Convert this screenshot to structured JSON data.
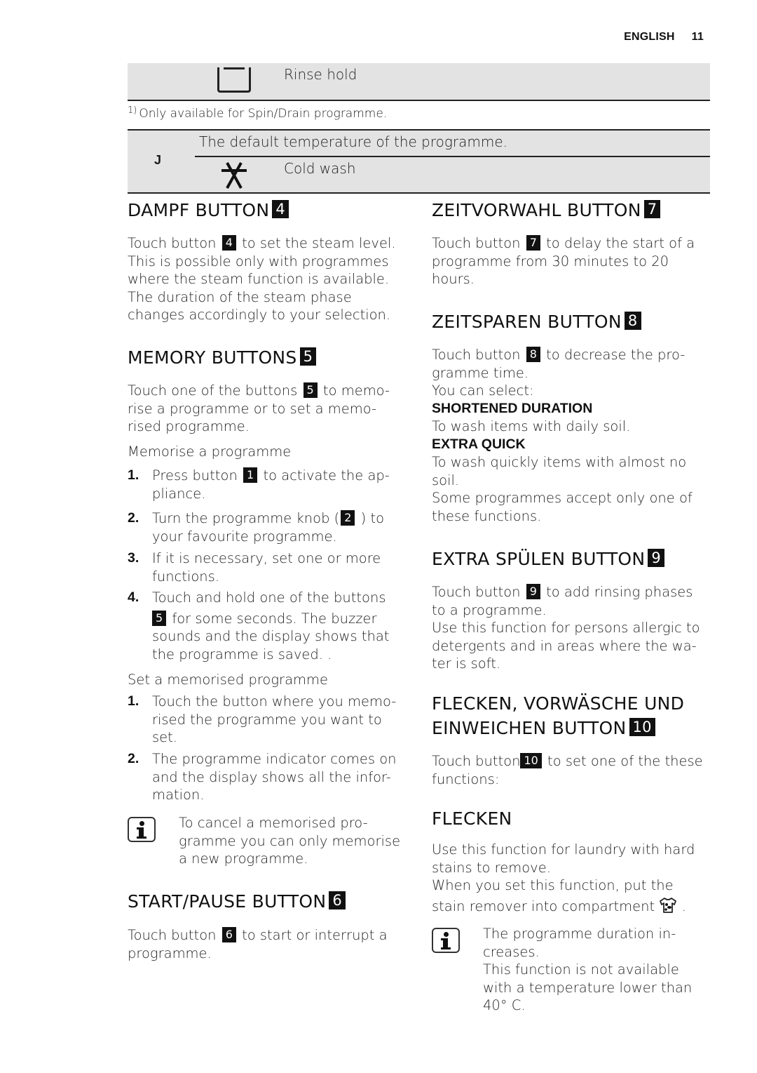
{
  "header": {
    "language": "ENGLISH",
    "page_number": "11"
  },
  "table": {
    "rinse_hold": {
      "icon": "rinse-hold-icon",
      "label": "Rinse hold"
    },
    "footnote": {
      "marker": "1)",
      "text": "Only available for Spin/Drain programme."
    },
    "temperature": {
      "key": "J",
      "description": "The default temperature of the programme.",
      "cold_wash": {
        "icon": "cold-wash-icon",
        "label": "Cold wash"
      }
    }
  },
  "left": {
    "dampf": {
      "title": "DAMPF BUTTON",
      "badge": "4",
      "p1_pre": "Touch button",
      "p1_badge": "4",
      "p1_post": "to set the steam level.",
      "lines": [
        "This is possible only with programmes",
        "where the steam function is available.",
        "The duration of the steam phase",
        "changes accordingly to your selection."
      ]
    },
    "memory": {
      "title": "MEMORY BUTTONS",
      "badge": "5",
      "intro_pre": "Touch one of the buttons",
      "intro_badge": "5",
      "intro_post": "to memo-",
      "intro_l2": "rise a programme or to set a memo-",
      "intro_l3": "rised programme.",
      "memorise_heading": "Memorise a programme",
      "steps": [
        {
          "n": "1.",
          "pre": "Press button",
          "badge": "1",
          "post": "to activate the ap-",
          "l2": "pliance."
        },
        {
          "n": "2.",
          "pre": "Turn the programme knob (",
          "badge": "2",
          "post": ") to",
          "l2": "your favourite programme."
        },
        {
          "n": "3.",
          "l1": "If it is necessary, set one or more",
          "l2": "functions."
        },
        {
          "n": "4.",
          "l1": "Touch and hold one of the buttons",
          "badge": "5",
          "post": "for some seconds. The buzzer",
          "l3": "sounds and the display shows that",
          "l4": "the programme is saved. ."
        }
      ],
      "set_heading": "Set a memorised programme",
      "set_steps": [
        {
          "n": "1.",
          "l1": "Touch the button where you memo-",
          "l2": "rised the programme you want to",
          "l3": "set."
        },
        {
          "n": "2.",
          "l1": "The programme indicator comes on",
          "l2": "and the display shows all the infor-",
          "l3": "mation."
        }
      ],
      "note": {
        "icon": "info-icon",
        "l1": "To cancel a memorised pro-",
        "l2": "gramme you can only memorise",
        "l3": "a new programme."
      }
    },
    "start_pause": {
      "title": "START/PAUSE BUTTON",
      "badge": "6",
      "pre": "Touch button",
      "p_badge": "6",
      "post": "to start or interrupt a",
      "l2": "programme."
    }
  },
  "right": {
    "zeitvorwahl": {
      "title": "ZEITVORWAHL BUTTON",
      "badge": "7",
      "pre": "Touch button",
      "p_badge": "7",
      "post": "to delay the start of a",
      "l2": "programme from 30 minutes to 20",
      "l3": "hours."
    },
    "zeitsparen": {
      "title": "ZEITSPAREN BUTTON",
      "badge": "8",
      "pre": "Touch button",
      "p_badge": "8",
      "post": "to decrease the pro-",
      "l2": "gramme time.",
      "l3": "You can select:",
      "option1_title": "SHORTENED DURATION",
      "option1_text": "To wash items with daily soil.",
      "option2_title": "EXTRA QUICK",
      "option2_l1": "To wash quickly items with almost no",
      "option2_l2": "soil.",
      "note_l1": "Some programmes accept only one of",
      "note_l2": "these functions."
    },
    "extra_spuelen": {
      "title": "EXTRA SPÜLEN BUTTON",
      "badge": "9",
      "pre": "Touch button",
      "p_badge": "9",
      "post": "to add rinsing phases",
      "l2": "to a programme.",
      "l3": "Use this function for persons allergic to",
      "l4": "detergents and in areas where the wa-",
      "l5": "ter is soft."
    },
    "flecken_group": {
      "title_l1": "FLECKEN, VORWÄSCHE UND",
      "title_l2": "EINWEICHEN BUTTON",
      "badge": "10",
      "pre": "Touch button",
      "p_badge": "10",
      "post": "to set one of the these",
      "l2": "functions:"
    },
    "flecken": {
      "title": "FLECKEN",
      "l1": "Use this function for laundry with hard",
      "l2": "stains to remove.",
      "l3": "When you set this function, put the",
      "l4_pre": "stain remover into compartment",
      "l4_icon": "stain-remover-compartment-icon",
      "l4_post": ".",
      "note": {
        "icon": "info-icon",
        "l1": "The programme duration in-",
        "l2": "creases.",
        "l3": "This function is not available",
        "l4": "with a temperature lower than",
        "l5": "40° C."
      }
    }
  }
}
